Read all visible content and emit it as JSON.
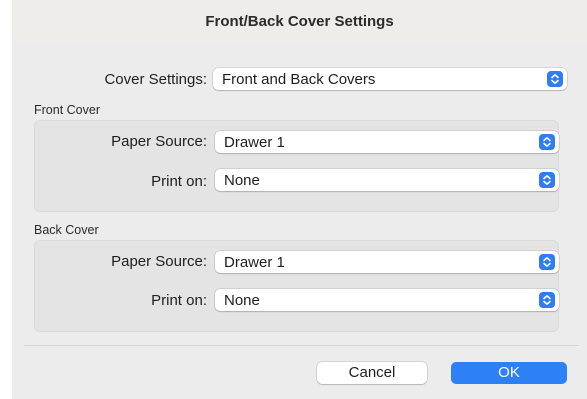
{
  "dialog": {
    "title": "Front/Back Cover Settings",
    "cover_settings_label": "Cover Settings:",
    "cover_settings_value": "Front and Back Covers",
    "front_cover": {
      "section_label": "Front Cover",
      "paper_source_label": "Paper Source:",
      "paper_source_value": "Drawer 1",
      "print_on_label": "Print on:",
      "print_on_value": "None"
    },
    "back_cover": {
      "section_label": "Back Cover",
      "paper_source_label": "Paper Source:",
      "paper_source_value": "Drawer 1",
      "print_on_label": "Print on:",
      "print_on_value": "None"
    },
    "cancel_label": "Cancel",
    "ok_label": "OK"
  },
  "icons": {
    "popup_stepper": "chevron-up-down-icon"
  },
  "colors": {
    "accent": "#2e80f7",
    "window_background": "#ececec",
    "group_background": "#e4e4e4"
  }
}
